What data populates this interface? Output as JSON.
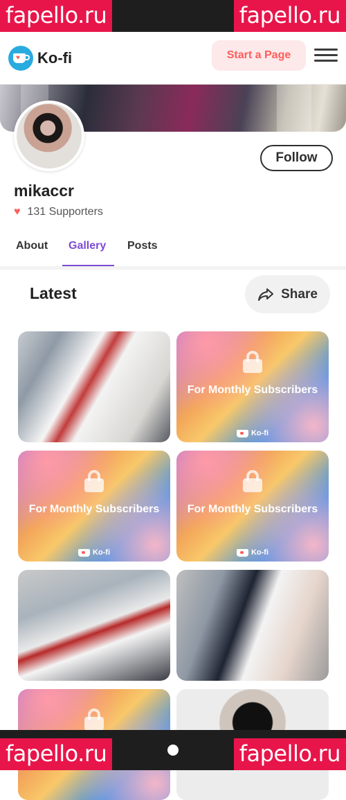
{
  "watermarks": [
    "fapello.ru",
    "fapello.ru",
    "fapello.ru",
    "fapello.ru"
  ],
  "header": {
    "logo_text": "Ko-fi",
    "start_label": "Start a Page"
  },
  "profile": {
    "username": "mikaccr",
    "supporters": "131 Supporters",
    "follow_label": "Follow"
  },
  "tabs": [
    {
      "label": "About",
      "active": false
    },
    {
      "label": "Gallery",
      "active": true
    },
    {
      "label": "Posts",
      "active": false
    }
  ],
  "gallery": {
    "heading": "Latest",
    "share_label": "Share",
    "locked_label": "For Monthly Subscribers",
    "badge_label": "Ko-fi"
  },
  "colors": {
    "accent": "#7d4bd4",
    "brand": "#ff5e5b",
    "logo_blue": "#29abe0"
  }
}
